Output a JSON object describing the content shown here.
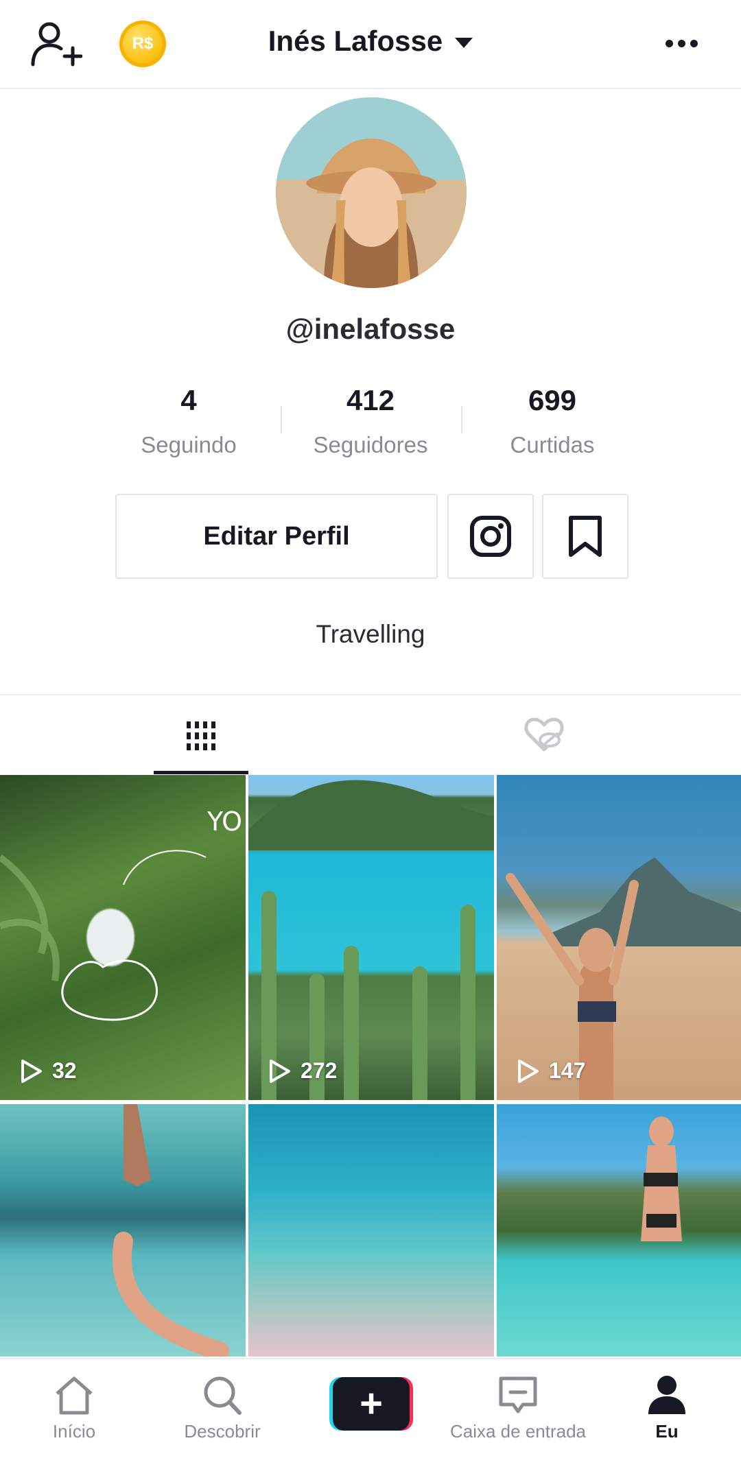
{
  "header": {
    "username_display": "Inés Lafosse",
    "coin_label": "R$"
  },
  "profile": {
    "handle": "@inelafosse",
    "bio": "Travelling"
  },
  "stats": [
    {
      "value": "4",
      "label": "Seguindo"
    },
    {
      "value": "412",
      "label": "Seguidores"
    },
    {
      "value": "699",
      "label": "Curtidas"
    }
  ],
  "actions": {
    "edit_label": "Editar Perfil"
  },
  "videos": [
    {
      "views": "32",
      "overlay_text": "YO"
    },
    {
      "views": "272"
    },
    {
      "views": "147"
    },
    {},
    {},
    {}
  ],
  "bottom_nav": [
    {
      "label": "Início",
      "icon": "home-icon"
    },
    {
      "label": "Descobrir",
      "icon": "search-icon"
    },
    {
      "label": "",
      "icon": "plus-icon"
    },
    {
      "label": "Caixa de entrada",
      "icon": "inbox-icon"
    },
    {
      "label": "Eu",
      "icon": "profile-icon",
      "active": true
    }
  ],
  "colors": {
    "accent_cyan": "#20d5ec",
    "accent_red": "#fe2c55",
    "text": "#161823",
    "muted": "#8a8b91",
    "coin": "#fcc419"
  }
}
